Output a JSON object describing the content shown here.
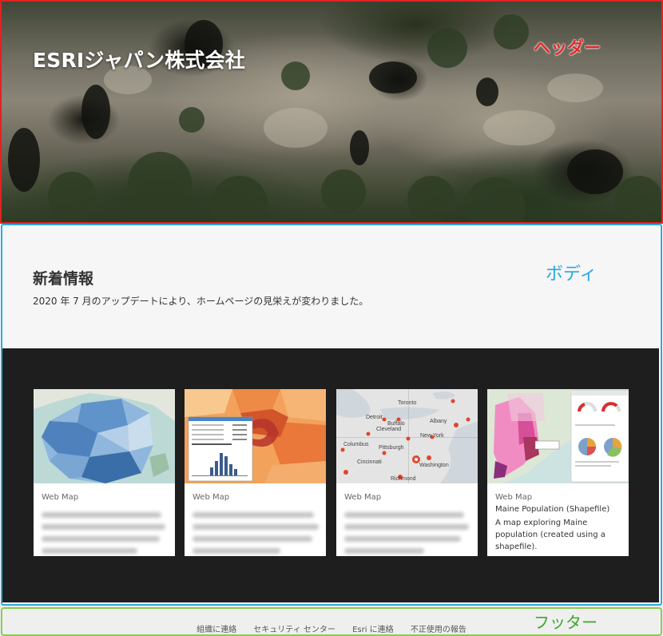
{
  "header": {
    "title": "ESRIジャパン株式会社"
  },
  "annotations": {
    "header_label": "ヘッダー",
    "body_label": "ボディ",
    "footer_label": "フッター"
  },
  "news": {
    "heading": "新着情報",
    "text": "2020 年 7 月のアップデートにより、ホームページの見栄えが変わりました。"
  },
  "cards": [
    {
      "type": "Web Map",
      "thumbnail": "france-map-thumbnail"
    },
    {
      "type": "Web Map",
      "thumbnail": "population-choropleth-thumbnail"
    },
    {
      "type": "Web Map",
      "thumbnail": "us-northeast-cities-thumbnail",
      "city_labels": [
        "Toronto",
        "Detroit",
        "Buffalo",
        "Albany",
        "Cleveland",
        "New York",
        "Columbus",
        "Pittsburgh",
        "Cincinnati",
        "Washington",
        "Richmond"
      ]
    },
    {
      "type": "Web Map",
      "thumbnail": "maine-dashboard-thumbnail",
      "title": "Maine Population (Shapefile)",
      "description": "A map exploring Maine population (created using a shapefile)."
    }
  ],
  "footer": {
    "links": [
      "組織に連絡",
      "セキュリティ センター",
      "Esri に連絡",
      "不正使用の報告"
    ]
  },
  "colors": {
    "header_frame": "#e22222",
    "body_frame": "#29a9e1",
    "footer_frame": "#8acc4e",
    "gallery_bg": "#1e1e1e",
    "intro_bg": "#f6f6f6"
  }
}
